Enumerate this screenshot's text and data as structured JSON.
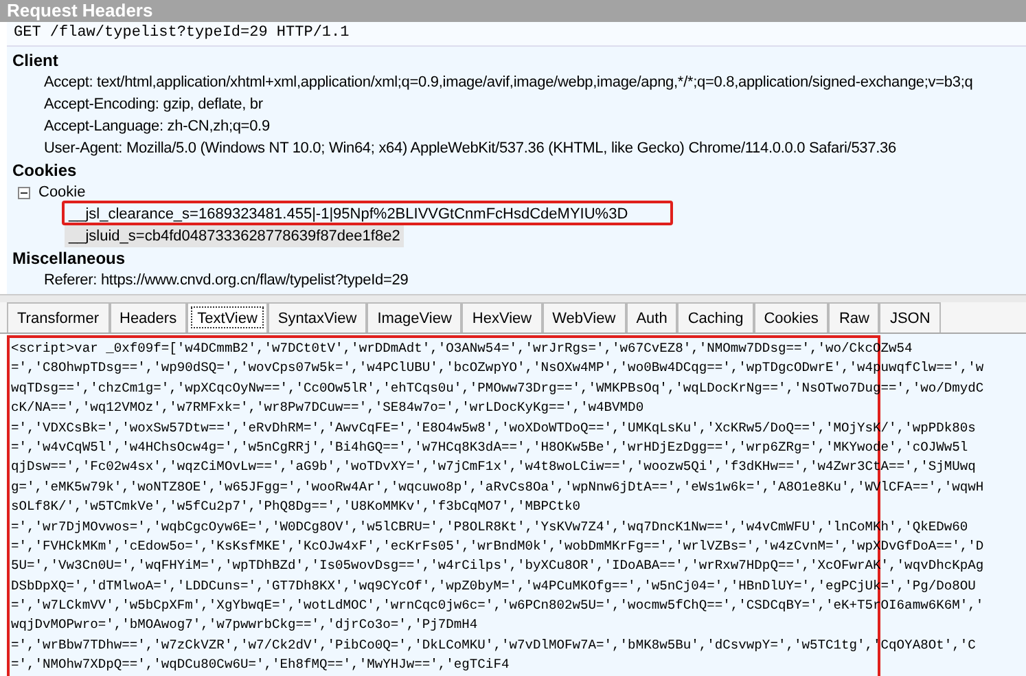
{
  "panel_title": "Request Headers",
  "request_line": "GET /flaw/typelist?typeId=29 HTTP/1.1",
  "groups": [
    {
      "title": "Client",
      "entries": [
        {
          "text": "Accept: text/html,application/xhtml+xml,application/xml;q=0.9,image/avif,image/webp,image/apng,*/*;q=0.8,application/signed-exchange;v=b3;q"
        },
        {
          "text": "Accept-Encoding: gzip, deflate, br"
        },
        {
          "text": "Accept-Language: zh-CN,zh;q=0.9"
        },
        {
          "text": "User-Agent: Mozilla/5.0 (Windows NT 10.0; Win64; x64) AppleWebKit/537.36 (KHTML, like Gecko) Chrome/114.0.0.0 Safari/537.36"
        }
      ]
    },
    {
      "title": "Cookies",
      "node": {
        "label": "Cookie",
        "expanded": true,
        "children": [
          {
            "text": "__jsl_clearance_s=1689323481.455|-1|95Npf%2BLIVVGtCnmFcHsdCdeMYIU%3D",
            "selected": false,
            "highlighted": true
          },
          {
            "text": "__jsluid_s=cb4fd0487333628778639f87dee1f8e2",
            "selected": true,
            "highlighted": false
          }
        ]
      }
    },
    {
      "title": "Miscellaneous",
      "entries": [
        {
          "text": "Referer: https://www.cnvd.org.cn/flaw/typelist?typeId=29"
        }
      ]
    }
  ],
  "tabs": [
    {
      "label": "Transformer",
      "selected": false
    },
    {
      "label": "Headers",
      "selected": false
    },
    {
      "label": "TextView",
      "selected": true
    },
    {
      "label": "SyntaxView",
      "selected": false
    },
    {
      "label": "ImageView",
      "selected": false
    },
    {
      "label": "HexView",
      "selected": false
    },
    {
      "label": "WebView",
      "selected": false
    },
    {
      "label": "Auth",
      "selected": false
    },
    {
      "label": "Caching",
      "selected": false
    },
    {
      "label": "Cookies",
      "selected": false
    },
    {
      "label": "Raw",
      "selected": false
    },
    {
      "label": "JSON",
      "selected": false
    }
  ],
  "text_view": {
    "highlighted": true,
    "lines": [
      "<script>var _0xf09f=['w4DCmmB2','w7DCt0tV','wrDDmAdt','O3ANw54=','wrJrRgs=','w67CvEZ8','NMOmw7DDsg==','wo/CkcOZw54",
      "=','C8OhwpTDsg==','wp90dSQ=','wovCps07w5k=','w4PClUBU','bcOZwpYO','NsOXw4MP','wo0Bw4DCqg==','wpTDgcODwrE','w4puwqfClw==','w",
      "wqTDsg==','chzCm1g=','wpXCqcOyNw==','Cc0Ow5lR','ehTCqs0u','PMOww73Drg==','WMKPBsOq','wqLDocKrNg==','NsOTwo7Dug==','wo/DmydC",
      "cK/NA==','wq12VMOz','w7RMFxk=','wr8Pw7DCuw==','SE84w7o=','wrLDocKyKg==','w4BVMD0",
      "=','VDXCsBk=','woxSw57Dtw==','eRvDhRM=','AwvCqFE=','E8O4w5w8','woXDoWTDoQ==','UMKqLsKu','XcKRw5/DoQ==','MOjYsK/','wpPDk80s",
      "=','w4vCqW5l','w4HChsOcw4g=','w5nCgRRj','Bi4hGQ==','w7HCq8K3dA==','H8OKw5Be','wrHDjEzDgg==','wrp6ZRg=','MKYwode','cOJWw5l",
      "qjDsw==','Fc02w4sx','wqzCiMOvLw==','aG9b','woTDvXY=','w7jCmF1x','w4t8woLCiw==','woozw5Qi','f3dKHw==','w4Zwr3CtA==','SjMUwq",
      "g=','eMK5w79k','woNTZ8OE','w65JFgg=','wooRw4Ar','wqcuwo8p','aRvCs8Oa','wpNnw6jDtA==','eWs1w6k=','A8O1e8Ku','WVlCFA==','wqwH",
      "sOLf8K/','w5TCmkVe','w5fCu2p7','PhQ8Dg==','U8KoMMKv','f3bCqMO7','MBPCtk0",
      "=','wr7DjMOvwos=','wqbCgcOyw6E=','W0DCg8OV','w5lCBRU=','P8OLR8Kt','YsKVw7Z4','wq7DncK1Nw==','w4vCmWFU','lnCoMKh','QkEDw60",
      "=','FVHCkMKm','cEdow5o=','KsKsfMKE','KcOJw4xF','ecKrFs05','wrBndM0k','wobDmMKrFg==','wrlVZBs=','w4zCvnM=','wpXDvGfDoA==','D",
      "5U=','Vw3Cn0U=','wqFHYiM=','wpTDhBZd','Is05wovDsg==','w4rCilps','byXCu8OR','IDoABA==','wrRxw7HDpQ==','XcOFwrAK','wqvDhcKpAg",
      "DSbDpXQ=','dTMlwoA=','LDDCuns=','GT7Dh8KX','wq9CYcOf','wpZ0byM=','w4PCuMKOfg==','w5nCj04=','HBnDlUY=','egPCjUk=','Pg/Do8OU",
      "=','w7LCkmVV','w5bCpXFm','XgYbwqE=','wotLdMOC','wrnCqc0jw6c=','w6PCn802w5U=','wocmw5fChQ==','CSDCqBY=','eK+T5rOI6amw6K6M','",
      "wqjDvMOPwro=','bMOAwog7','w7pwwrbCkg==','djrCo3o=','Pj7DmH4",
      "=','wrBbw7TDhw==','w7zCkVZR','w7/Ck2dV','PibCo0Q=','DkLCoMKU','w7vDlMOFw7A=','bMK8w5Bu','dCsvwpY=','w5TC1tg','CqOYA8Ot','C",
      "=','NMOhw7XDpQ==','wqDCu80Cw6U=','Eh8fMQ==','MwYHJw==','egTCiF4"
    ]
  }
}
